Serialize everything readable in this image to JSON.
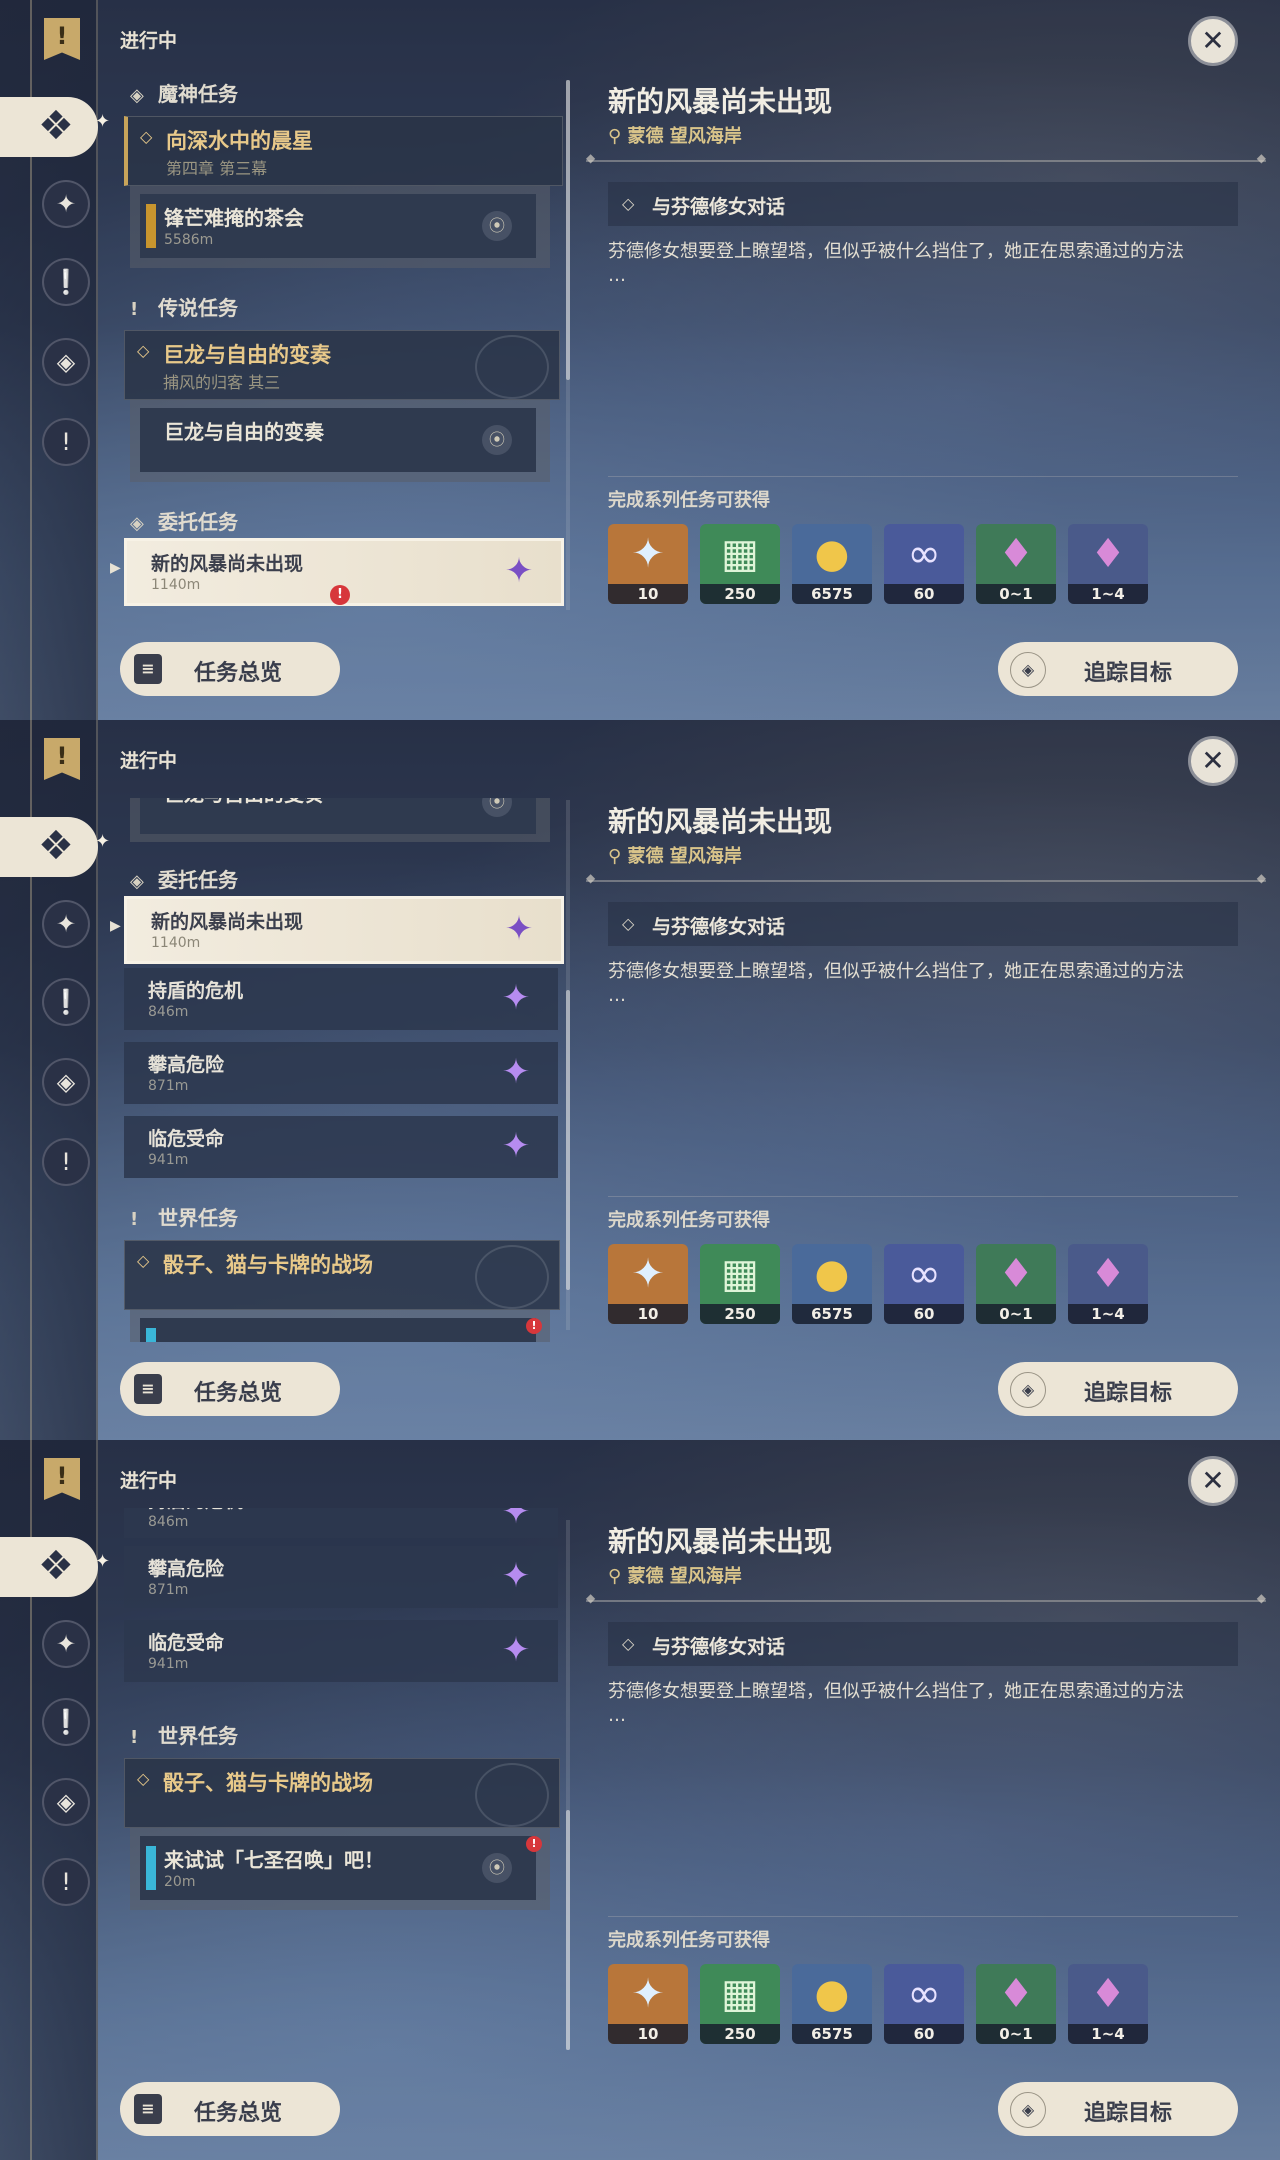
{
  "panel_status": "进行中",
  "icons": {
    "banner": "quest-banner-icon",
    "active_nav": "archon-quest-icon",
    "close": "close-icon",
    "pin": "location-pin-icon",
    "commission_star": "commission-star-icon"
  },
  "categories": {
    "archon": "魔神任务",
    "legend": "传说任务",
    "commission": "委托任务",
    "world": "世界任务"
  },
  "quests": {
    "archon_main": {
      "title": "向深水中的晨星",
      "sub": "第四章 第三幕"
    },
    "archon_sub": {
      "title": "锋芒难掩的茶会",
      "dist": "5586m"
    },
    "legend_main": {
      "title": "巨龙与自由的变奏",
      "sub": "捕风的归客 其三"
    },
    "legend_sub": {
      "title": "巨龙与自由的变奏"
    },
    "commissions": [
      {
        "title": "新的风暴尚未出现",
        "dist": "1140m"
      },
      {
        "title": "持盾的危机",
        "dist": "846m"
      },
      {
        "title": "攀高危险",
        "dist": "871m"
      },
      {
        "title": "临危受命",
        "dist": "941m"
      }
    ],
    "world_main": {
      "title": "骰子、猫与卡牌的战场"
    },
    "world_sub": {
      "title": "来试试「七圣召唤」吧！",
      "dist": "20m"
    }
  },
  "detail": {
    "title": "新的风暴尚未出现",
    "location": "蒙德 望风海岸",
    "objective": "与芬德修女对话",
    "description_line1": "芬德修女想要登上瞭望塔，但似乎被什么挡住了，她正在思索通过的方法",
    "description_line2": "…",
    "rewards_title": "完成系列任务可获得",
    "rewards": [
      {
        "name": "primogem-icon",
        "qty": "10",
        "color": "#b8763a"
      },
      {
        "name": "adventure-exp-icon",
        "qty": "250",
        "color": "#3f8a58"
      },
      {
        "name": "mora-icon",
        "qty": "6575",
        "color": "#4a6a9a"
      },
      {
        "name": "companionship-exp-icon",
        "qty": "60",
        "color": "#4a5a9a"
      },
      {
        "name": "crystal-chunk-icon",
        "qty": "0~1",
        "color": "#3f7a58"
      },
      {
        "name": "crystal-cluster-icon",
        "qty": "1~4",
        "color": "#4a5a8a"
      }
    ]
  },
  "buttons": {
    "overview": "任务总览",
    "track": "追踪目标"
  },
  "colors": {
    "accent_gold": "#e8c98a",
    "cream": "#ece5d6",
    "alert_red": "#d7373b",
    "commission_purple": "#b68cf0"
  }
}
